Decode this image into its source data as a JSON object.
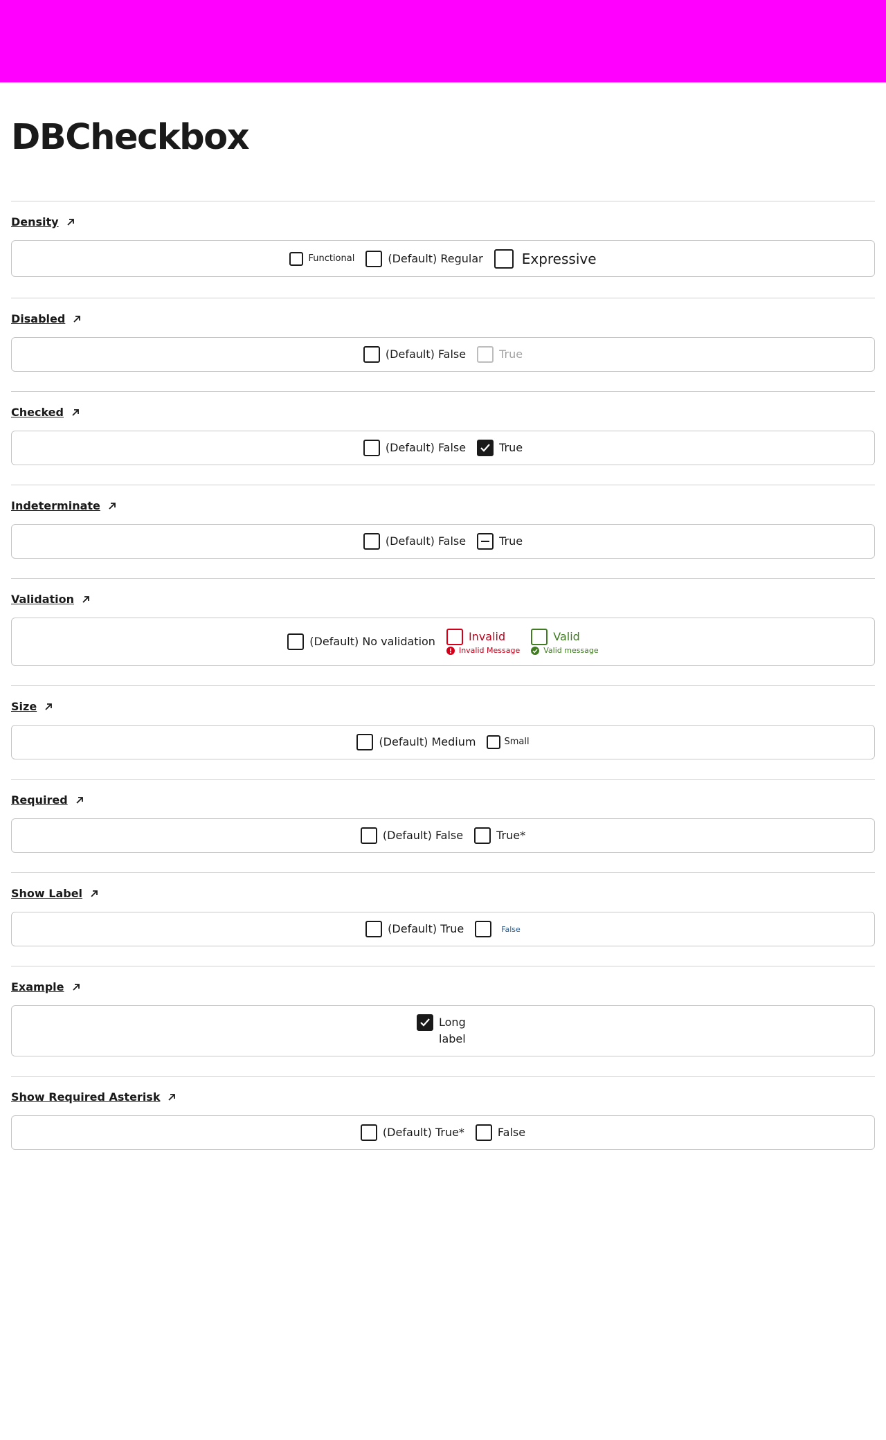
{
  "page": {
    "title": "DBCheckbox"
  },
  "colors": {
    "header_band": "#ff00ff",
    "invalid": "#c0001a",
    "valid": "#3f7d20",
    "checkbox_border": "#1a1a1a",
    "disabled": "#a3a3a3"
  },
  "sections": {
    "density": {
      "heading": "Density",
      "items": [
        "Functional",
        "(Default) Regular",
        "Expressive"
      ]
    },
    "disabled": {
      "heading": "Disabled",
      "items": [
        "(Default) False",
        "True"
      ]
    },
    "checked": {
      "heading": "Checked",
      "items": [
        "(Default) False",
        "True"
      ]
    },
    "indeterminate": {
      "heading": "Indeterminate",
      "items": [
        "(Default) False",
        "True"
      ]
    },
    "validation": {
      "heading": "Validation",
      "items": [
        "(Default) No validation",
        "Invalid",
        "Valid"
      ],
      "invalid_message": "Invalid Message",
      "valid_message": "Valid message"
    },
    "size": {
      "heading": "Size",
      "items": [
        "(Default) Medium",
        "Small"
      ]
    },
    "required": {
      "heading": "Required",
      "items": [
        "(Default) False",
        "True*"
      ]
    },
    "show_label": {
      "heading": "Show Label",
      "items": [
        "(Default) True",
        "False"
      ]
    },
    "example": {
      "heading": "Example",
      "items": [
        "Long label"
      ]
    },
    "show_required_asterisk": {
      "heading": "Show Required Asterisk",
      "items": [
        "(Default) True*",
        "False"
      ]
    }
  }
}
